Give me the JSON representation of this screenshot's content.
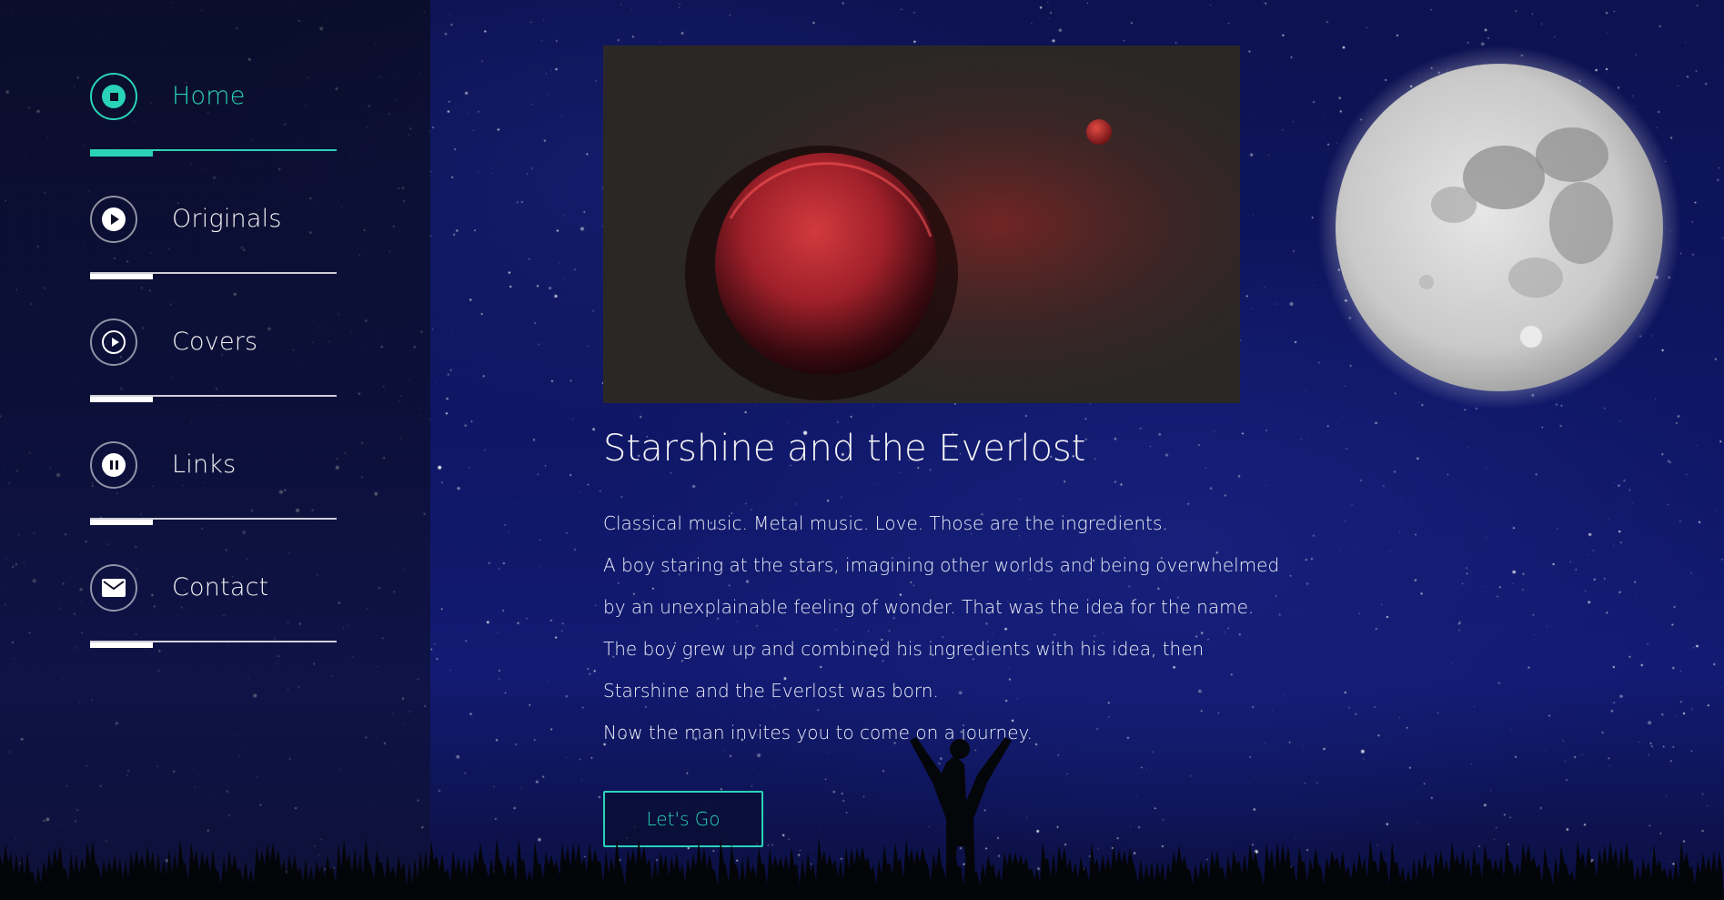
{
  "nav": {
    "items": [
      {
        "label": "Home",
        "icon": "stop-icon",
        "active": true
      },
      {
        "label": "Originals",
        "icon": "play-icon",
        "active": false
      },
      {
        "label": "Covers",
        "icon": "play-circle-icon",
        "active": false
      },
      {
        "label": "Links",
        "icon": "pause-icon",
        "active": false
      },
      {
        "label": "Contact",
        "icon": "envelope-icon",
        "active": false
      }
    ]
  },
  "main": {
    "title": "Starshine and the Everlost",
    "paragraphs": [
      "Classical music. Metal music. Love. Those are the ingredients.",
      "A boy staring at the stars, imagining other worlds and being overwhelmed",
      "by an unexplainable feeling of wonder. That was the idea for the name.",
      "The boy grew up and combined his ingredients with his idea, then",
      "Starshine and the Everlost was born.",
      "Now the man invites you to come on a journey."
    ],
    "cta_label": "Let's Go"
  },
  "colors": {
    "accent": "#2ad3b8",
    "background": "#0f1664",
    "sidebar": "#0c0e24",
    "planet": "#b3202a"
  }
}
